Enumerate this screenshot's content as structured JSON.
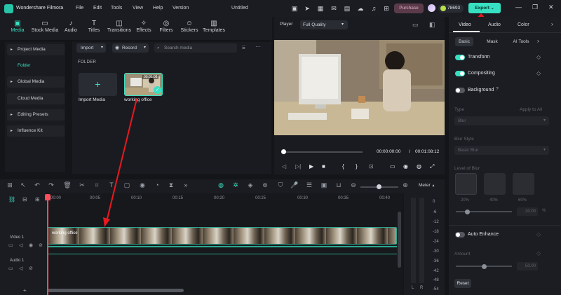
{
  "app": {
    "name": "Wondershare Filmora",
    "menu": [
      "File",
      "Edit",
      "Tools",
      "View",
      "Help",
      "Version"
    ],
    "doc_title": "Untitled",
    "purchase_label": "Purchase",
    "credits": "78693",
    "export_label": "Export"
  },
  "toolbar": {
    "items": [
      "Media",
      "Stock Media",
      "Audio",
      "Titles",
      "Transitions",
      "Effects",
      "Filters",
      "Stickers",
      "Templates"
    ]
  },
  "sidebar": {
    "items": [
      "Project Media",
      "Folder",
      "Global Media",
      "Cloud Media",
      "Editing Presets",
      "Influence Kit"
    ]
  },
  "media": {
    "import_dropdown": "Import",
    "record_dropdown": "Record",
    "search_placeholder": "Search media",
    "folder_heading": "FOLDER",
    "import_label": "Import Media",
    "clip_label": "working office",
    "clip_duration": "00:01:08"
  },
  "player": {
    "title": "Player",
    "quality": "Full Quality",
    "current_time": "00:00:00:00",
    "separator": "/",
    "total_time": "00:01:08:12"
  },
  "properties": {
    "tabs": [
      "Video",
      "Audio",
      "Color"
    ],
    "subtabs": [
      "Basic",
      "Mask",
      "AI Tools"
    ],
    "transform": "Transform",
    "compositing": "Compositing",
    "background": "Background",
    "type_label": "Type",
    "apply_all": "Apply to All",
    "type_value": "Blur",
    "blur_style_label": "Blur Style",
    "blur_style_value": "Basic Blur",
    "blur_level_label": "Level of Blur",
    "levels": [
      "20%",
      "40%",
      "60%"
    ],
    "blur_value": "20.00",
    "percent_unit": "%",
    "auto_enhance": "Auto Enhance",
    "amount_label": "Amount",
    "amount_value": "50.00",
    "reset_label": "Reset",
    "blur_level": 0.2,
    "amount_level": 0.5
  },
  "timeline": {
    "meter_label": "Meter",
    "ruler_labels": [
      "00:00",
      "00:05",
      "00:10",
      "00:15",
      "00:20",
      "00:25",
      "00:30",
      "00:35",
      "00:40"
    ],
    "video_track": "Video 1",
    "audio_track": "Audio 1",
    "clip_label": "working office",
    "meter_scale": [
      "0",
      "-6",
      "-12",
      "-18",
      "-24",
      "-30",
      "-36",
      "-42",
      "-48",
      "-54"
    ],
    "lr": [
      "L",
      "R"
    ]
  }
}
